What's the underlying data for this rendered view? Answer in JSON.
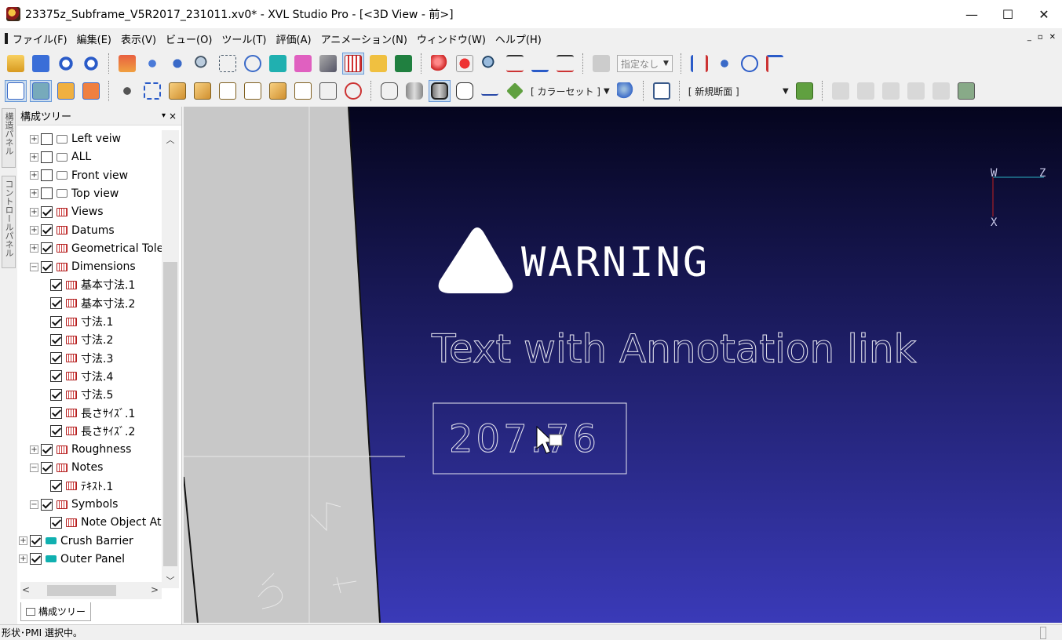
{
  "window": {
    "title": "23375z_Subframe_V5R2017_231011.xv0* - XVL Studio Pro - [<3D View - 前>]",
    "minimize": "—",
    "maximize": "☐",
    "close": "✕"
  },
  "menu": [
    "ファイル(F)",
    "編集(E)",
    "表示(V)",
    "ビュー(O)",
    "ツール(T)",
    "評価(A)",
    "アニメーション(N)",
    "ウィンドウ(W)",
    "ヘルプ(H)"
  ],
  "mdi_controls": [
    "_",
    "▫",
    "✕"
  ],
  "toolbar": {
    "combo_none": "指定なし",
    "color_set": "[ カラーセット ]",
    "new_section": "[ 新規断面 ]"
  },
  "side_tabs": [
    "構造パネル",
    "コントロールパネル"
  ],
  "tree_panel": {
    "title": "構成ツリー",
    "pin": "▾",
    "close": "×",
    "bottom_tab": "構成ツリー",
    "items": [
      {
        "label": "Left veiw",
        "level": 1,
        "expander": "+",
        "checked": false,
        "icon": "cam"
      },
      {
        "label": "ALL",
        "level": 1,
        "expander": "+",
        "checked": false,
        "icon": "cam"
      },
      {
        "label": "Front view",
        "level": 1,
        "expander": "+",
        "checked": false,
        "icon": "cam"
      },
      {
        "label": "Top view",
        "level": 1,
        "expander": "+",
        "checked": false,
        "icon": "cam"
      },
      {
        "label": "Views",
        "level": 1,
        "expander": "+",
        "checked": true,
        "icon": "pmi"
      },
      {
        "label": "Datums",
        "level": 1,
        "expander": "+",
        "checked": true,
        "icon": "pmi"
      },
      {
        "label": "Geometrical Tolera",
        "level": 1,
        "expander": "+",
        "checked": true,
        "icon": "pmi"
      },
      {
        "label": "Dimensions",
        "level": 1,
        "expander": "−",
        "checked": true,
        "icon": "pmi"
      },
      {
        "label": "基本寸法.1",
        "level": 2,
        "expander": "",
        "checked": true,
        "icon": "pmi"
      },
      {
        "label": "基本寸法.2",
        "level": 2,
        "expander": "",
        "checked": true,
        "icon": "pmi"
      },
      {
        "label": "寸法.1",
        "level": 2,
        "expander": "",
        "checked": true,
        "icon": "pmi"
      },
      {
        "label": "寸法.2",
        "level": 2,
        "expander": "",
        "checked": true,
        "icon": "pmi"
      },
      {
        "label": "寸法.3",
        "level": 2,
        "expander": "",
        "checked": true,
        "icon": "pmi"
      },
      {
        "label": "寸法.4",
        "level": 2,
        "expander": "",
        "checked": true,
        "icon": "pmi"
      },
      {
        "label": "寸法.5",
        "level": 2,
        "expander": "",
        "checked": true,
        "icon": "pmi"
      },
      {
        "label": "長さｻｲｽﾞ.1",
        "level": 2,
        "expander": "",
        "checked": true,
        "icon": "pmi"
      },
      {
        "label": "長さｻｲｽﾞ.2",
        "level": 2,
        "expander": "",
        "checked": true,
        "icon": "pmi"
      },
      {
        "label": "Roughness",
        "level": 1,
        "expander": "+",
        "checked": true,
        "icon": "pmi"
      },
      {
        "label": "Notes",
        "level": 1,
        "expander": "−",
        "checked": true,
        "icon": "pmi"
      },
      {
        "label": "ﾃｷｽﾄ.1",
        "level": 2,
        "expander": "",
        "checked": true,
        "icon": "pmi"
      },
      {
        "label": "Symbols",
        "level": 1,
        "expander": "−",
        "checked": true,
        "icon": "pmi"
      },
      {
        "label": "Note Object At",
        "level": 2,
        "expander": "",
        "checked": true,
        "icon": "pmi"
      },
      {
        "label": "Crush Barrier",
        "level": 0,
        "expander": "+",
        "checked": true,
        "icon": "part"
      },
      {
        "label": "Outer Panel",
        "level": 0,
        "expander": "+",
        "checked": true,
        "icon": "part"
      }
    ]
  },
  "viewport": {
    "warning_text": "WARNING",
    "annotation_text": "Text with Annotation link",
    "dimension_value": "207.76",
    "axis_labels": {
      "w": "W",
      "z": "Z",
      "x": "X"
    },
    "colors": {
      "bg_top": "#05051e",
      "bg_bottom": "#3a3ab8",
      "gray_body": "#c8c8c8",
      "axis_z": "#2ab0c0",
      "axis_x": "#c02020"
    }
  },
  "status": {
    "text": "形状･PMI 選択中｡"
  }
}
